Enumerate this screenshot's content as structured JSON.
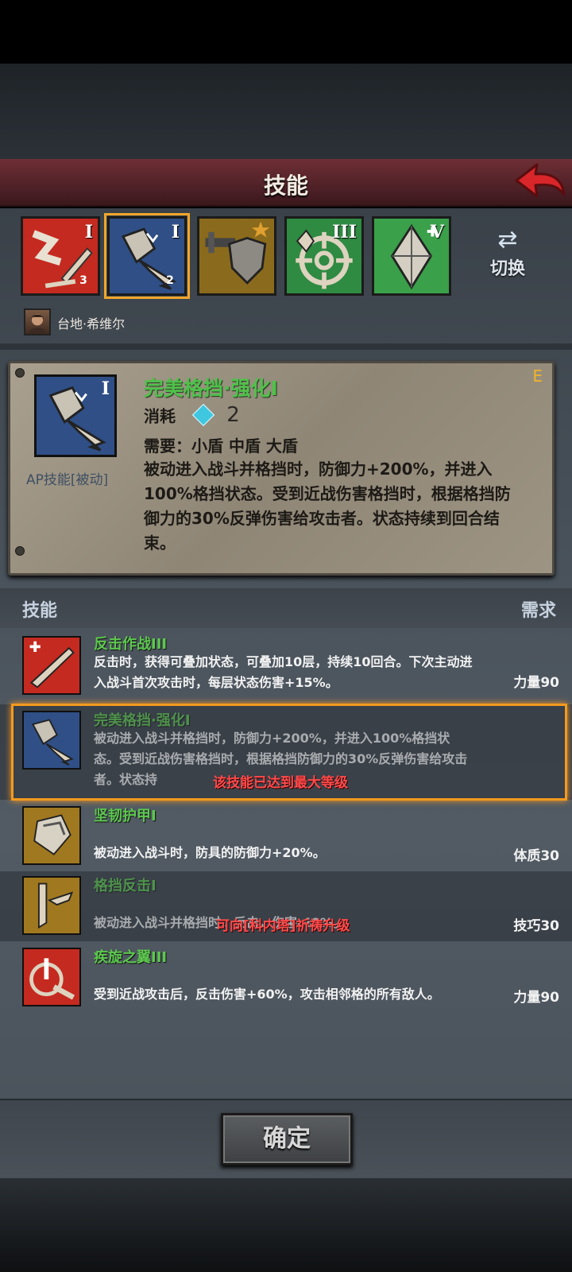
{
  "header": {
    "title": "技能"
  },
  "tabs": [
    {
      "name": "反击作战",
      "level": "I",
      "badge": "3",
      "color": "#c42a20",
      "selected": false
    },
    {
      "name": "完美格挡·强化",
      "level": "I",
      "badge": "2",
      "color": "#2f4f86",
      "selected": true
    },
    {
      "name": "格挡反击",
      "level": "",
      "badge": "",
      "color": "#a07820",
      "selected": false
    },
    {
      "name": "瞄准",
      "level": "III",
      "badge": "",
      "color": "#2f8a42",
      "selected": false
    },
    {
      "name": "晶体",
      "level": "V",
      "badge": "",
      "color": "#3aa04a",
      "selected": false
    }
  ],
  "switch": {
    "label": "切换"
  },
  "character": {
    "name": "台地·希维尔"
  },
  "detail": {
    "grade": "E",
    "level": "I",
    "title": "完美格挡·强化I",
    "cost_label": "消耗",
    "cost_value": "2",
    "requires": "需要：小盾 中盾 大盾",
    "type_label": "AP技能[被动]",
    "description": "被动进入战斗并格挡时，防御力+200%，并进入100%格挡状态。受到近战伤害格挡时，根据格挡防御力的30%反弹伤害给攻击者。状态持续到回合结束。"
  },
  "list_header": {
    "skill": "技能",
    "requirement": "需求"
  },
  "skills": [
    {
      "name": "反击作战III",
      "desc": "反击时，获得可叠加状态，可叠加10层，持续10回合。下次主动进入战斗首次攻击时，每层状态伤害+15%。",
      "req": "力量90",
      "color": "#c42a20"
    },
    {
      "name": "完美格挡·强化I",
      "desc": "被动进入战斗并格挡时，防御力+200%，并进入100%格挡状态。受到近战伤害格挡时，根据格挡防御力的30%反弹伤害给攻击者。状态持",
      "req": "",
      "overlay": "该技能已达到最大等级",
      "color": "#2f4f86"
    },
    {
      "name": "坚韧护甲I",
      "desc": "被动进入战斗时，防具的防御力+20%。",
      "req": "体质30",
      "color": "#a07820"
    },
    {
      "name": "格挡反击I",
      "desc": "被动进入战斗并格挡时，反击，伤害-40%。",
      "req": "技巧30",
      "overlay": "可向[科内塔]祈祷升级",
      "color": "#a07820"
    },
    {
      "name": "疾旋之翼III",
      "desc": "受到近战攻击后，反击伤害+60%，攻击相邻格的所有敌人。",
      "req": "力量90",
      "color": "#c42a20"
    }
  ],
  "confirm": {
    "label": "确定"
  }
}
